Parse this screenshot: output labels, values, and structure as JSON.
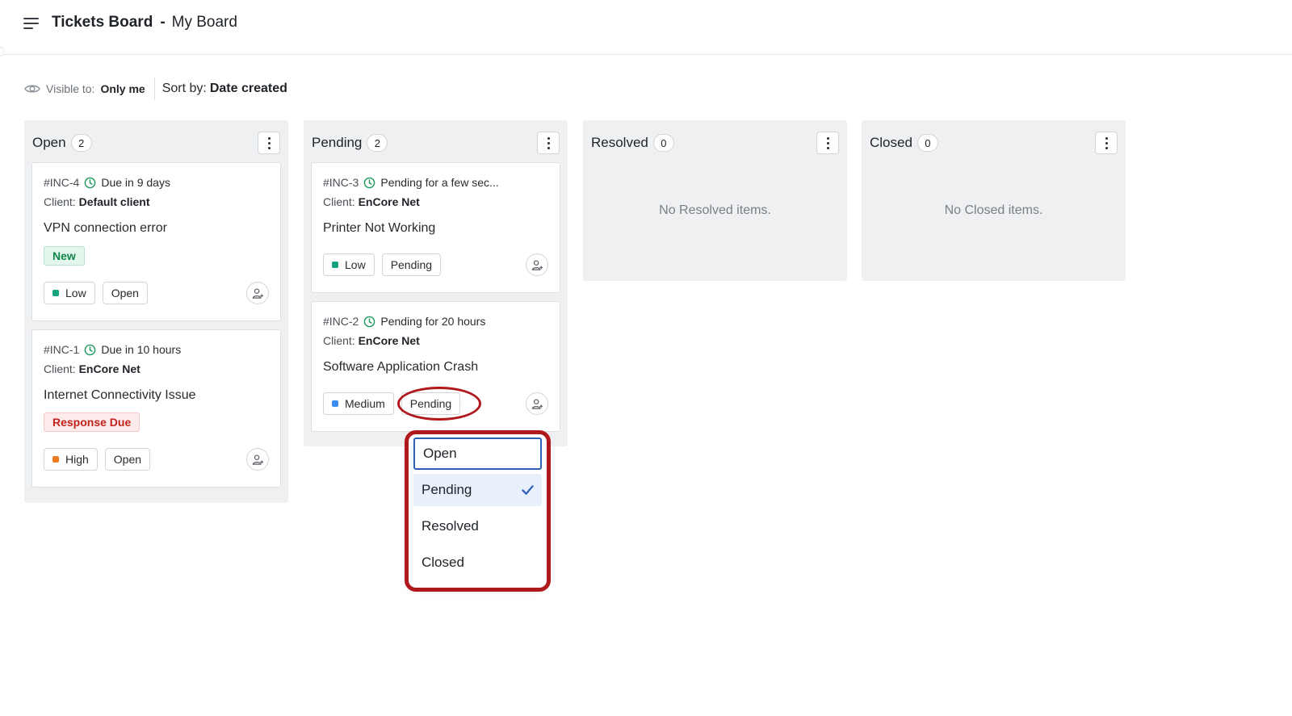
{
  "header": {
    "title": "Tickets Board",
    "separator": "-",
    "board_name": "My Board"
  },
  "toolbar": {
    "visible_label": "Visible to:",
    "visible_value": "Only me",
    "sort_label": "Sort by:",
    "sort_value": "Date created"
  },
  "colors": {
    "low": "#14a37f",
    "medium": "#3d8ef0",
    "high": "#f07b1d",
    "clock": "#1a9a5a",
    "annotation": "#b0191c",
    "focus": "#2d5fb8"
  },
  "columns": [
    {
      "title": "Open",
      "count": "2",
      "cards": [
        {
          "id": "#INC-4",
          "due": "Due in 9 days",
          "client_label": "Client:",
          "client": "Default client",
          "title": "VPN connection error",
          "badge": "New",
          "priority": "Low",
          "status": "Open"
        },
        {
          "id": "#INC-1",
          "due": "Due in 10 hours",
          "client_label": "Client:",
          "client": "EnCore Net",
          "title": "Internet Connectivity Issue",
          "badge": "Response Due",
          "priority": "High",
          "status": "Open"
        }
      ]
    },
    {
      "title": "Pending",
      "count": "2",
      "cards": [
        {
          "id": "#INC-3",
          "due": "Pending for a few sec...",
          "client_label": "Client:",
          "client": "EnCore Net",
          "title": "Printer Not Working",
          "priority": "Low",
          "status": "Pending"
        },
        {
          "id": "#INC-2",
          "due": "Pending for 20 hours",
          "client_label": "Client:",
          "client": "EnCore Net",
          "title": "Software Application Crash",
          "priority": "Medium",
          "status": "Pending"
        }
      ]
    },
    {
      "title": "Resolved",
      "count": "0",
      "empty": "No Resolved items."
    },
    {
      "title": "Closed",
      "count": "0",
      "empty": "No Closed items."
    }
  ],
  "status_dropdown": {
    "options": [
      "Open",
      "Pending",
      "Resolved",
      "Closed"
    ],
    "selected": "Pending",
    "focused": "Open"
  }
}
